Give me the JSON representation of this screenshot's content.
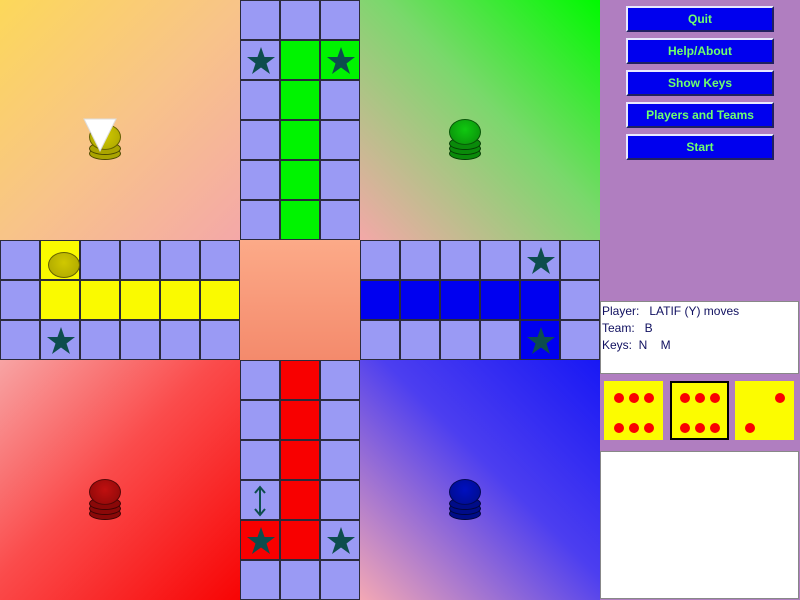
{
  "colors": {
    "track": "#9a9af4",
    "yellow": "#fafa00",
    "green": "#00f400",
    "blue": "#0000f0",
    "red": "#f80000",
    "star": "#0d4d4d",
    "button_bg": "#0000ee",
    "button_text": "#6eff6e",
    "sidebar_bg": "#b07ec0",
    "die_face": "#fcfc00",
    "pip": "#fa0000"
  },
  "menu": {
    "quit": "Quit",
    "help_about": "Help/About",
    "show_keys": "Show Keys",
    "players_teams": "Players and Teams",
    "start": "Start"
  },
  "status": {
    "player": "Player:   LATIF (Y) moves",
    "team": "Team:   B",
    "keys": "Keys:  N    M"
  },
  "dice": [
    {
      "value": 6,
      "selected": false
    },
    {
      "value": 6,
      "selected": true
    },
    {
      "value": 2,
      "selected": false
    }
  ],
  "pawns": {
    "yellow_home_count": 3,
    "green_home_count": 4,
    "red_home_count": 4,
    "blue_home_count": 4,
    "yellow_on_track": 1
  },
  "icons": {
    "safe_square": "star-icon",
    "turn_pointer": "triangle-pointer-icon",
    "direction": "double-arrow-icon"
  }
}
